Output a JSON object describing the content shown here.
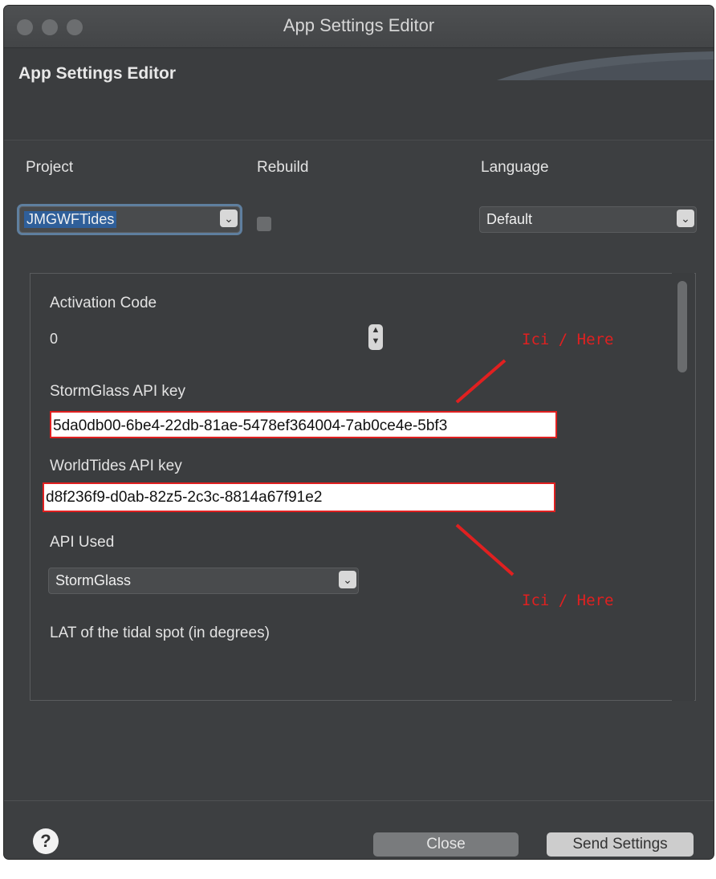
{
  "window": {
    "title": "App Settings Editor"
  },
  "header": {
    "title": "App Settings Editor"
  },
  "labels": {
    "project": "Project",
    "rebuild": "Rebuild",
    "language": "Language"
  },
  "project": {
    "value": "JMGWFTides"
  },
  "rebuild": {
    "checked": false
  },
  "language": {
    "value": "Default"
  },
  "settings": {
    "activation_code": {
      "label": "Activation Code",
      "value": "0"
    },
    "stormglass_key": {
      "label": "StormGlass API key",
      "value": "5da0db00-6be4-22db-81ae-5478ef364004-7ab0ce4e-5bf3"
    },
    "worldtides_key": {
      "label": "WorldTides API key",
      "value": "d8f236f9-d0ab-82z5-2c3c-8814a67f91e2"
    },
    "api_used": {
      "label": "API Used",
      "value": "StormGlass"
    },
    "lat": {
      "label": "LAT of the tidal spot (in degrees)"
    }
  },
  "annotations": {
    "top": "Ici / Here",
    "bottom": "Ici / Here",
    "color": "#e02020"
  },
  "footer": {
    "help_icon": "?",
    "close_label": "Close",
    "send_label": "Send Settings"
  }
}
